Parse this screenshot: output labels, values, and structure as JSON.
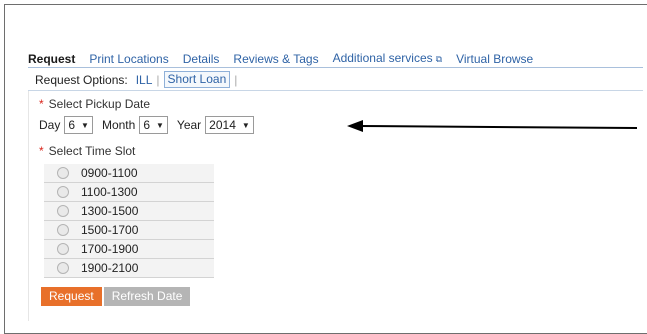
{
  "tabs": [
    {
      "label": "Request"
    },
    {
      "label": "Print Locations"
    },
    {
      "label": "Details"
    },
    {
      "label": "Reviews & Tags"
    },
    {
      "label": "Additional services"
    },
    {
      "label": "Virtual Browse"
    }
  ],
  "options": {
    "label": "Request Options:",
    "ill": "ILL",
    "short_loan": "Short Loan"
  },
  "pickup": {
    "label": "Select Pickup Date",
    "day_label": "Day",
    "day_value": "6",
    "month_label": "Month",
    "month_value": "6",
    "year_label": "Year",
    "year_value": "2014"
  },
  "timeslot": {
    "label": "Select Time Slot",
    "slots": [
      "0900-1100",
      "1100-1300",
      "1300-1500",
      "1500-1700",
      "1700-1900",
      "1900-2100"
    ]
  },
  "buttons": {
    "request": "Request",
    "refresh": "Refresh Date"
  },
  "colors": {
    "link": "#2f63a6",
    "primary_button": "#e8702a",
    "secondary_button": "#b5b5b5",
    "required": "#d9261c"
  }
}
